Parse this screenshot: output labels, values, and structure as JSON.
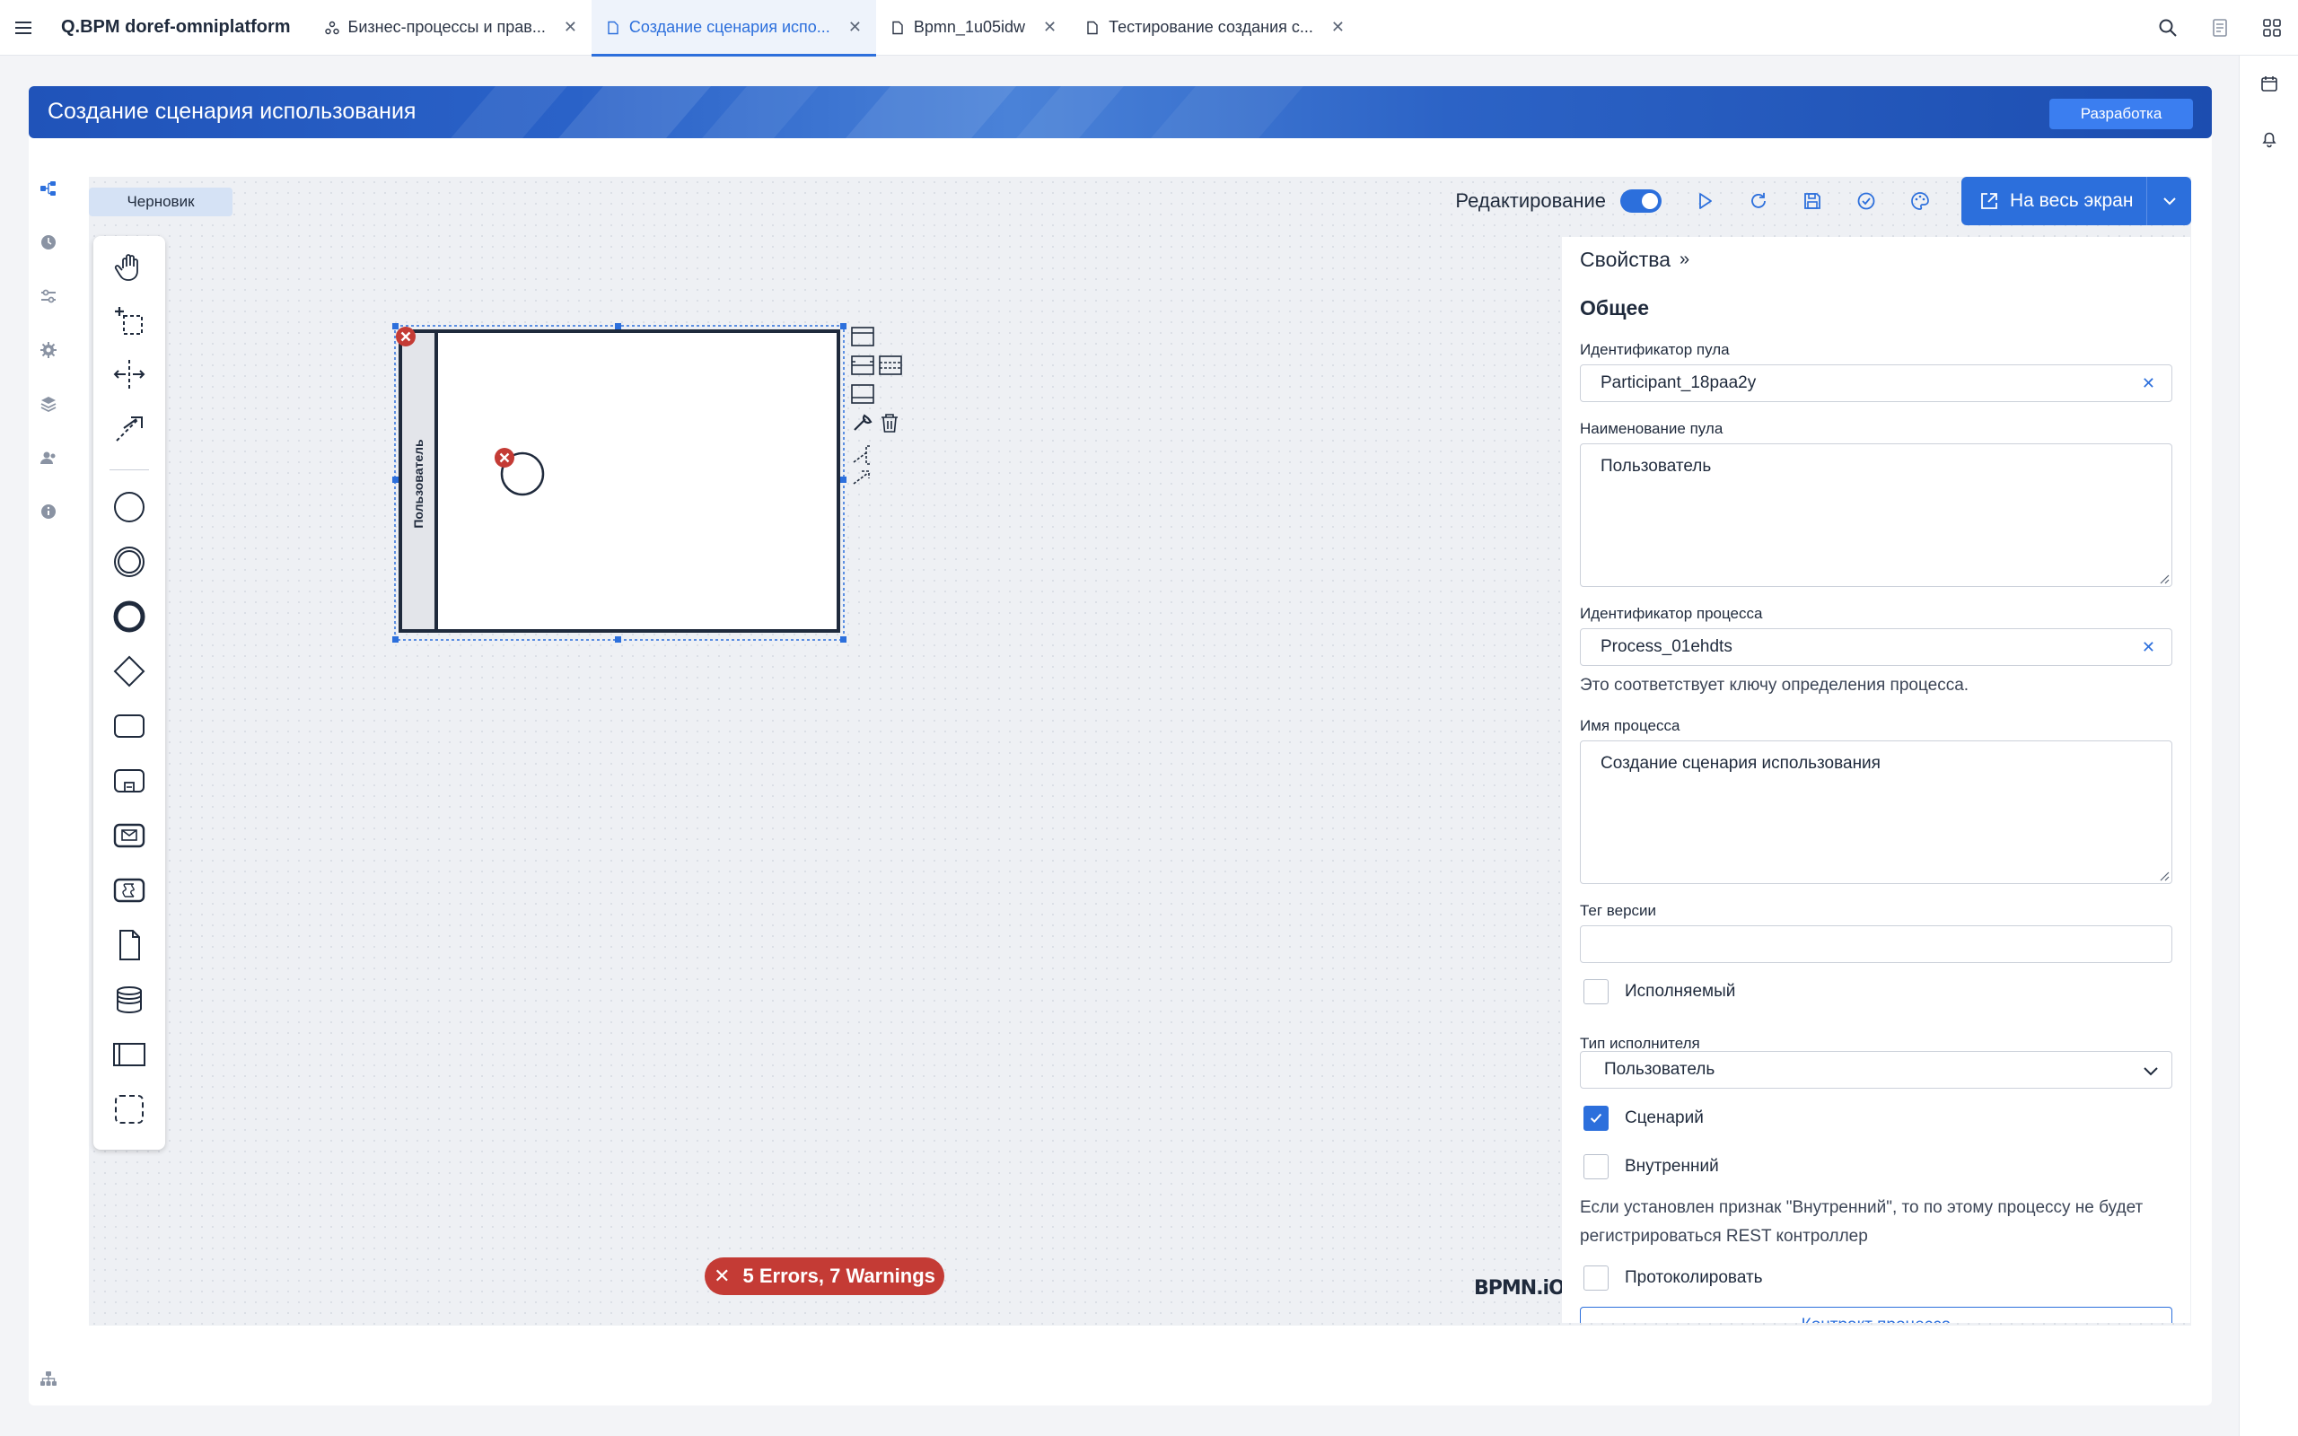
{
  "topbar": {
    "app_title": "Q.BPM doref-omniplatform",
    "tabs": [
      {
        "label": "Бизнес-процессы и прав...",
        "active": false
      },
      {
        "label": "Создание сценария испо...",
        "active": true
      },
      {
        "label": "Bpmn_1u05idw",
        "active": false
      },
      {
        "label": "Тестирование создания с...",
        "active": false
      }
    ]
  },
  "banner": {
    "title": "Создание сценария использования",
    "env_badge": "Разработка"
  },
  "canvas": {
    "status_badge": "Черновик",
    "edit_label": "Редактирование",
    "edit_enabled": true,
    "fullscreen_label": "На весь экран",
    "errors_text": "5 Errors, 7 Warnings",
    "watermark": "BPMN.iO"
  },
  "diagram": {
    "pool_label": "Пользователь"
  },
  "properties": {
    "header": "Свойства",
    "section_title": "Общее",
    "pool_id_label": "Идентификатор пула",
    "pool_id_value": "Participant_18paa2y",
    "pool_name_label": "Наименование пула",
    "pool_name_value": "Пользователь",
    "process_id_label": "Идентификатор процесса",
    "process_id_value": "Process_01ehdts",
    "process_id_hint": "Это соответствует ключу определения процесса.",
    "process_name_label": "Имя процесса",
    "process_name_value": "Создание сценария использования",
    "version_tag_label": "Тег версии",
    "version_tag_value": "",
    "executable_label": "Исполняемый",
    "executable_checked": false,
    "performer_type_label": "Тип исполнителя",
    "performer_type_value": "Пользователь",
    "scenario_label": "Сценарий",
    "scenario_checked": true,
    "internal_label": "Внутренний",
    "internal_checked": false,
    "internal_hint": "Если установлен признак \"Внутренний\", то по этому процессу не будет регистрироваться REST контроллер",
    "log_label": "Протоколировать",
    "log_checked": false,
    "contract_button": "Контракт процесса"
  },
  "colors": {
    "accent": "#2c6fdc",
    "error": "#c43b35",
    "banner": "#2053b9"
  }
}
